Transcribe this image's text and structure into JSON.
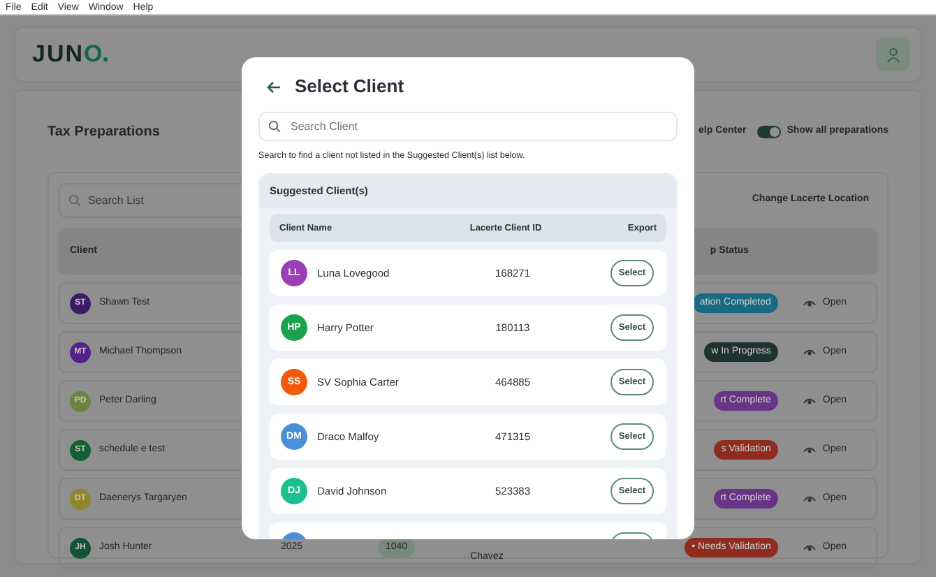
{
  "menu": [
    "File",
    "Edit",
    "View",
    "Window",
    "Help"
  ],
  "app": {
    "logo": "JUNO",
    "title": "Tax Preparations",
    "help_link": "elp Center",
    "toggle": {
      "label": "Show all preparations",
      "on": true
    },
    "search": {
      "placeholder": "Search List"
    },
    "change_location": "Change Lacerte Location",
    "columns": [
      "Client",
      "p Status"
    ],
    "rows": [
      {
        "initials": "ST",
        "name": "Shawn Test",
        "color": "#3b1b66",
        "status": {
          "text": "ation Completed",
          "color": "#186a80"
        },
        "action": "Open"
      },
      {
        "initials": "MT",
        "name": "Michael Thompson",
        "color": "#52218a",
        "status": {
          "text": "w In Progress",
          "color": "#1e3330"
        },
        "action": "Open"
      },
      {
        "initials": "PD",
        "name": "Peter Darling",
        "color": "#6b8440",
        "status": {
          "text": "rt Complete",
          "color": "#683586"
        },
        "action": "Open"
      },
      {
        "initials": "ST",
        "name": "schedule e test",
        "color": "#155f35",
        "status": {
          "text": "s Validation",
          "color": "#8f2c20"
        },
        "action": "Open"
      },
      {
        "initials": "DT",
        "name": "Daenerys Targaryen",
        "color": "#8e8628",
        "status": {
          "text": "rt Complete",
          "color": "#683586"
        },
        "action": "Open"
      },
      {
        "initials": "JH",
        "name": "Josh Hunter",
        "color": "#135234",
        "year": "2025",
        "form": "1040",
        "preparer": "Chavez",
        "status": {
          "text": "• Needs Validation",
          "color": "#8f2c20"
        },
        "action": "Open"
      }
    ]
  },
  "modal": {
    "title": "Select Client",
    "search": {
      "placeholder": "Search Client"
    },
    "hint": "Search to find a client not listed in the Suggested Client(s) list below.",
    "panel_title": "Suggested Client(s)",
    "columns": [
      "Client Name",
      "Lacerte Client ID",
      "Export"
    ],
    "clients": [
      {
        "initials": "LL",
        "name": "Luna Lovegood",
        "id": "168271",
        "color": "#9b3fb5",
        "button": "Select"
      },
      {
        "initials": "HP",
        "name": "Harry Potter",
        "id": "180113",
        "color": "#1aa34a",
        "button": "Select"
      },
      {
        "initials": "SS",
        "name": "SV Sophia Carter",
        "id": "464885",
        "color": "#f05a0a",
        "button": "Select"
      },
      {
        "initials": "DM",
        "name": "Draco Malfoy",
        "id": "471315",
        "color": "#4a8fd8",
        "button": "Select"
      },
      {
        "initials": "DJ",
        "name": "David Johnson",
        "id": "523383",
        "color": "#1cc08e",
        "button": "Select"
      }
    ],
    "cut_row": {
      "color": "#4a8fd8"
    }
  }
}
